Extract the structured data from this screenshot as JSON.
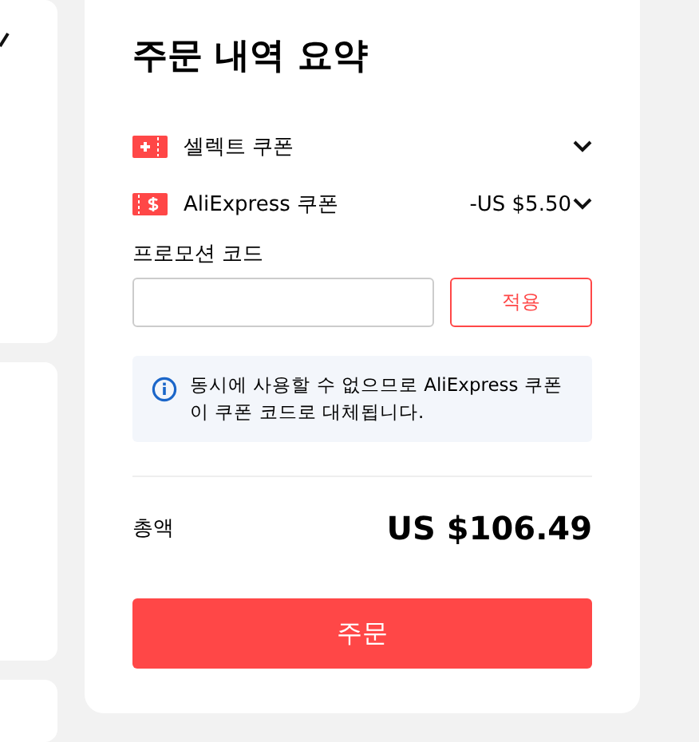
{
  "title": "주문 내역 요약",
  "coupons": [
    {
      "kind": "select",
      "label": "셀렉트 쿠폰",
      "expanded": false
    },
    {
      "kind": "dollar",
      "label": "AliExpress 쿠폰",
      "value": "-US $5.50",
      "expanded": false
    }
  ],
  "promo": {
    "label": "프로모션 코드",
    "button": "적용"
  },
  "notice": "동시에 사용할 수 없으므로 AliExpress 쿠폰이 쿠폰 코드로 대체됩니다.",
  "total": {
    "label": "총액",
    "value": "US $106.49"
  },
  "order_button": "주문"
}
